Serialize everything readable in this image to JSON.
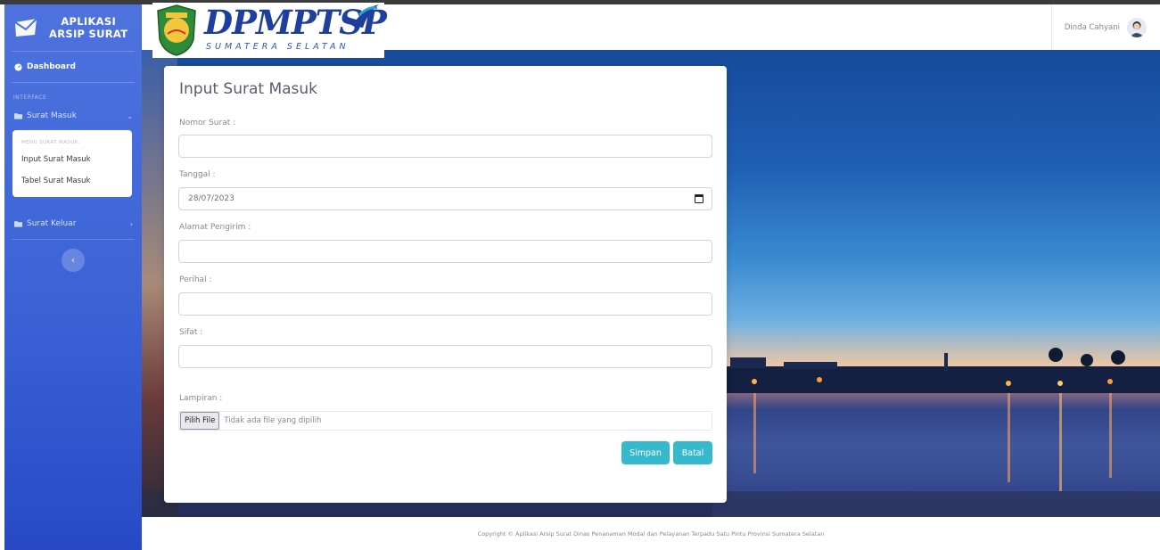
{
  "sidebar": {
    "brand_line1": "APLIKASI",
    "brand_line2": "ARSIP SURAT",
    "dashboard_label": "Dashboard",
    "section_heading": "INTERFACE",
    "surat_masuk_label": "Surat Masuk",
    "submenu_heading": "MENU SURAT MASUK:",
    "submenu_items": [
      "Input Surat Masuk",
      "Tabel Surat Masuk"
    ],
    "surat_keluar_label": "Surat Keluar",
    "toggle_glyph": "‹"
  },
  "topbar": {
    "logo_text": "DPMPTSP",
    "logo_subtext": "SUMATERA SELATAN",
    "user_name": "Dinda Cahyani"
  },
  "form": {
    "title": "Input Surat Masuk",
    "nomor_label": "Nomor Surat :",
    "nomor_value": "",
    "tanggal_label": "Tanggal :",
    "tanggal_value": "28/07/2023",
    "alamat_label": "Alamat Pengirim :",
    "alamat_value": "",
    "perihal_label": "Perihal :",
    "perihal_value": "",
    "sifat_label": "Sifat :",
    "sifat_value": "",
    "lampiran_label": "Lampiran :",
    "file_button_label": "Pilih File",
    "file_status": "Tidak ada file yang dipilih",
    "save_label": "Simpan",
    "cancel_label": "Batal"
  },
  "footer": {
    "copyright": "Copyright © Aplikasi Arsip Surat Dinas Penanaman Modal dan Pelayanan Terpadu Satu Pintu Provinsi Sumatera Selatan"
  },
  "colors": {
    "sidebar_primary": "#4e73df",
    "button_info": "#36b9cc",
    "logo_blue": "#1f3f9e"
  }
}
